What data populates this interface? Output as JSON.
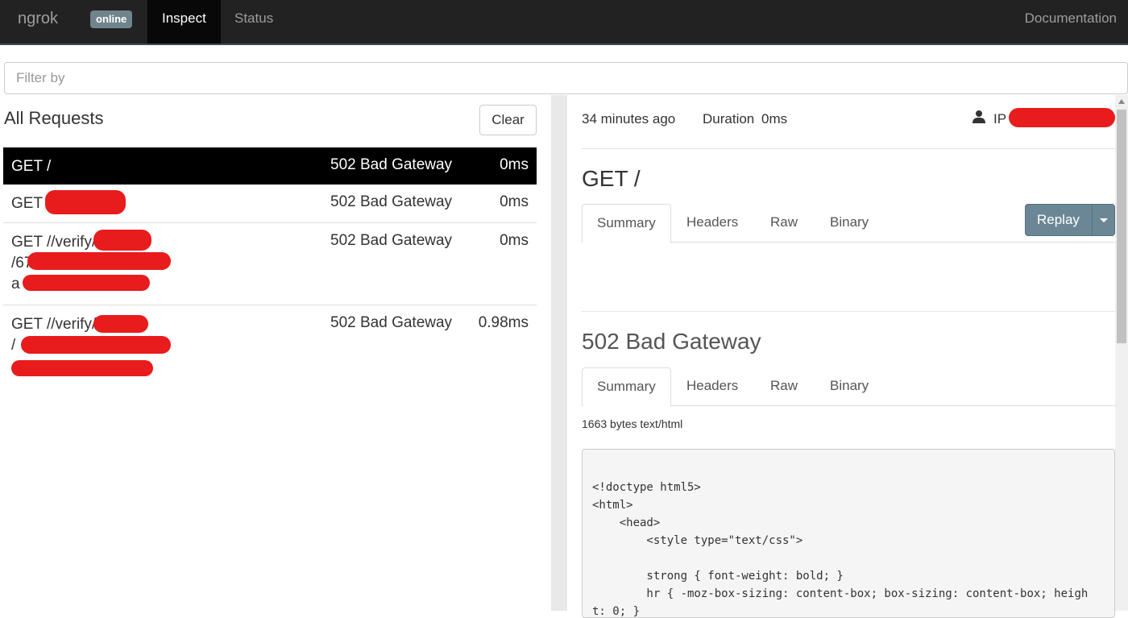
{
  "navbar": {
    "brand": "ngrok",
    "status_badge": "online",
    "tabs": [
      {
        "label": "Inspect",
        "active": true
      },
      {
        "label": "Status",
        "active": false
      }
    ],
    "documentation": "Documentation"
  },
  "filter": {
    "placeholder": "Filter by",
    "value": ""
  },
  "requests_panel": {
    "title": "All Requests",
    "clear_label": "Clear",
    "requests": [
      {
        "method_path": "GET /",
        "status": "502 Bad Gateway",
        "duration": "0ms",
        "selected": true
      },
      {
        "method_path": "GET",
        "status": "502 Bad Gateway",
        "duration": "0ms",
        "selected": false
      },
      {
        "method_path": "GET //verify/",
        "path_line2": "/67b",
        "path_line3": "a",
        "status": "502 Bad Gateway",
        "duration": "0ms",
        "selected": false
      },
      {
        "method_path": "GET //verify/",
        "path_line2": "/",
        "path_line3": "",
        "status": "502 Bad Gateway",
        "duration": "0.98ms",
        "selected": false
      }
    ]
  },
  "detail": {
    "time_ago": "34 minutes ago",
    "duration_label": "Duration",
    "duration_value": "0ms",
    "ip_label": "IP",
    "request_title": "GET /",
    "request_tabs": [
      "Summary",
      "Headers",
      "Raw",
      "Binary"
    ],
    "replay_label": "Replay",
    "response_title": "502 Bad Gateway",
    "response_tabs": [
      "Summary",
      "Headers",
      "Raw",
      "Binary"
    ],
    "response_meta": "1663 bytes text/html",
    "response_body": "<!doctype html5>\n<html>\n    <head>\n        <style type=\"text/css\">\n\n        strong { font-weight: bold; }\n        hr { -moz-box-sizing: content-box; box-sizing: content-box; heigh\nt: 0; }"
  },
  "colors": {
    "navbar_bg": "#222222",
    "selected_row_bg": "#000000",
    "replay_bg": "#6b8796",
    "redaction": "#e81c1c"
  }
}
